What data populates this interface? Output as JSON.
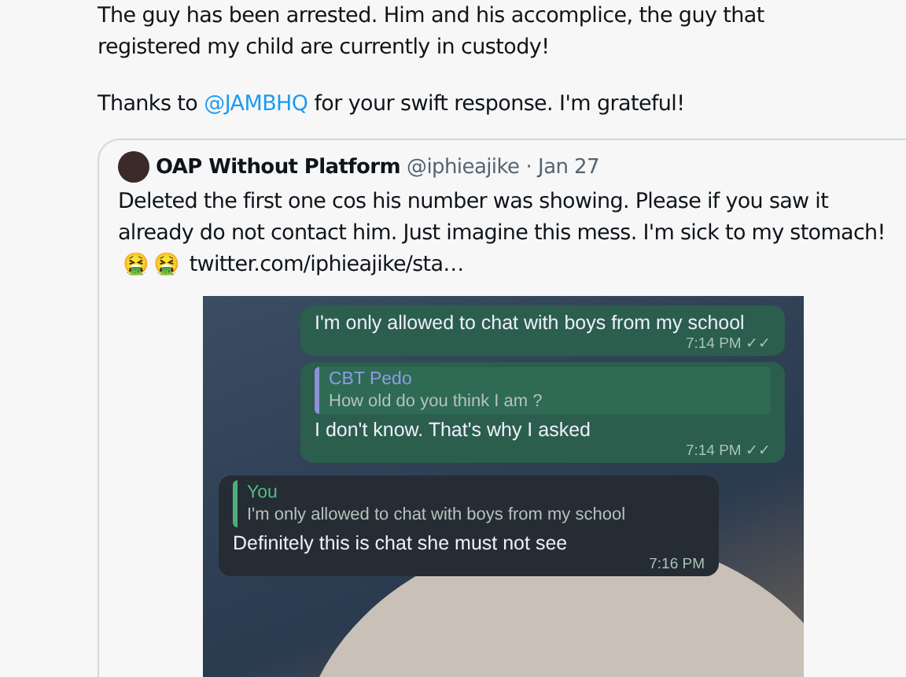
{
  "tweet": {
    "text_lines": [
      "The guy has been arrested. Him and his accomplice, the guy that",
      "registered my child are currently in custody!"
    ],
    "thanks": {
      "before": "Thanks to",
      "mention": "@JAMBHQ",
      "after": "for your swift response. I'm grateful!"
    }
  },
  "quoted_tweet": {
    "name": "OAP Without Platform",
    "handle": "@iphieajike",
    "separator": "·",
    "date": "Jan 27",
    "text": "Deleted the first one cos his number was showing. Please if you saw it already do not contact him. Just imagine this mess. I'm sick to my stomach!",
    "emojis": [
      "🤮",
      "🤮"
    ],
    "link": "twitter.com/iphieajike/sta…",
    "chat": [
      {
        "kind": "outgoing",
        "text": "I'm only allowed to chat with boys from my school",
        "time": "7:14 PM",
        "ticks": "✓✓"
      },
      {
        "kind": "outgoing",
        "reply_name": "CBT Pedo",
        "reply_text": "How old do you think I am ?",
        "text": "I don't know. That's why I asked",
        "time": "7:14 PM",
        "ticks": "✓✓"
      },
      {
        "kind": "incoming",
        "reply_name": "You",
        "reply_text": "I'm only allowed to chat with boys from my school",
        "text": "Definitely this is chat she must not see",
        "time": "7:16 PM"
      }
    ]
  }
}
